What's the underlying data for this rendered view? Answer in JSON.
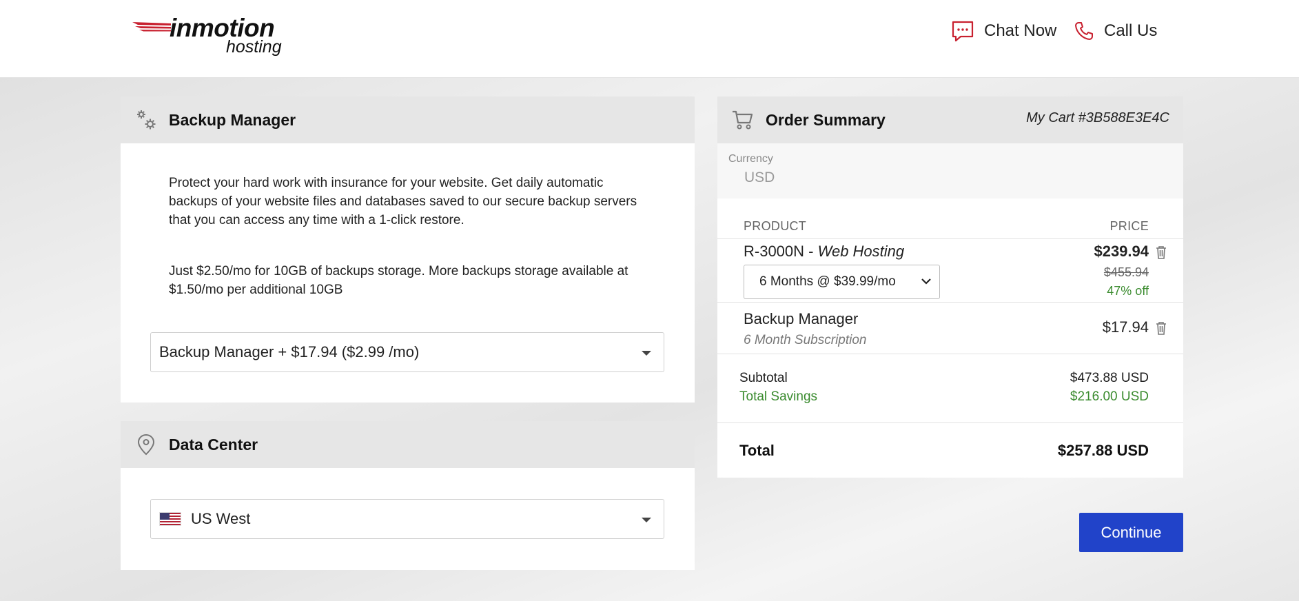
{
  "header": {
    "logo_main": "inmotion",
    "logo_sub": "hosting",
    "chat_label": "Chat Now",
    "call_label": "Call Us",
    "accent_color": "#c8202f"
  },
  "backup_manager": {
    "title": "Backup Manager",
    "description_1": "Protect your hard work with insurance for your website. Get daily automatic backups of your website files and databases saved to our secure backup servers that you can access any time with a 1-click restore.",
    "description_2": "Just $2.50/mo for 10GB of backups storage. More backups storage available at $1.50/mo per additional 10GB",
    "selected_option": "Backup Manager + $17.94 ($2.99 /mo)"
  },
  "data_center": {
    "title": "Data Center",
    "selected_option": "US West"
  },
  "order_summary": {
    "title": "Order Summary",
    "cart_id": "My Cart #3B588E3E4C",
    "currency_label": "Currency",
    "currency_value": "USD",
    "col_product": "PRODUCT",
    "col_price": "PRICE",
    "items": [
      {
        "name": "R-3000N - ",
        "type": "Web Hosting",
        "price": "$239.94",
        "term_option": "6 Months @ $39.99/mo",
        "original_price": "$455.94",
        "discount": "47% off"
      },
      {
        "name": "Backup Manager",
        "subtitle": "6 Month Subscription",
        "price": "$17.94"
      }
    ],
    "subtotal_label": "Subtotal",
    "subtotal_value": "$473.88 USD",
    "savings_label": "Total Savings",
    "savings_value": "$216.00 USD",
    "total_label": "Total",
    "total_value": "$257.88 USD"
  },
  "actions": {
    "continue_label": "Continue",
    "button_color": "#2143c9"
  }
}
